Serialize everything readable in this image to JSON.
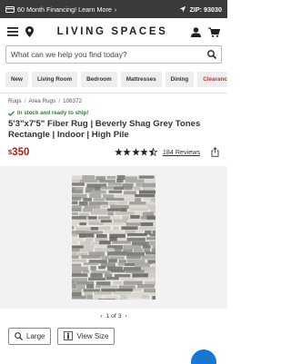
{
  "promo": {
    "financing_text": "60 Month Financing! Learn More",
    "zip_text": "ZIP: 93030"
  },
  "header": {
    "logo": "LIVING SPACES"
  },
  "search": {
    "placeholder": "What can we help you find today?"
  },
  "categories": [
    "New",
    "Living Room",
    "Bedroom",
    "Mattresses",
    "Dining",
    "Clearance"
  ],
  "breadcrumb": {
    "items": [
      "Rugs",
      "Area Rugs",
      "108372"
    ]
  },
  "product": {
    "stock_text": "In stock and ready to ship!",
    "title": "5'3\"x7'5\" Fiber Rug | Beverly Shag Grey Tones Rectangle | Indoor | High Pile",
    "currency": "$",
    "price": "350",
    "rating": 4.5,
    "reviews_text": "184 Reviews"
  },
  "gallery": {
    "pager_text": "1 of 3"
  },
  "actions": {
    "large_label": "Large",
    "view_size_label": "View Size"
  },
  "colors": {
    "accent_red": "#b71c1c",
    "stock_green": "#2e7d32",
    "chat_blue": "#1976d2"
  }
}
